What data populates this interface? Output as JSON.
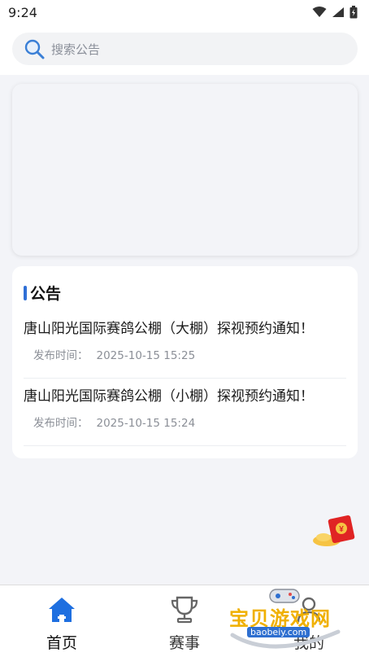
{
  "status_bar": {
    "time": "9:24"
  },
  "search": {
    "placeholder": "搜索公告"
  },
  "notice": {
    "title": "公告",
    "items": [
      {
        "title": "唐山阳光国际赛鸽公棚（大棚）探视预约通知！",
        "meta_label": "发布时间：",
        "date": "2025-10-15 15:25"
      },
      {
        "title": "唐山阳光国际赛鸽公棚（小棚）探视预约通知！",
        "meta_label": "发布时间：",
        "date": "2025-10-15 15:24"
      }
    ]
  },
  "tabs": [
    {
      "label": "首页",
      "icon": "home-icon",
      "active": true
    },
    {
      "label": "赛事",
      "icon": "trophy-icon",
      "active": false
    },
    {
      "label": "我的",
      "icon": "user-icon",
      "active": false
    }
  ],
  "watermark": {
    "name": "宝贝游戏网",
    "url": "baobeiy.com"
  },
  "colors": {
    "accent": "#2f6fd6",
    "tab_active": "#1e6fe0"
  }
}
